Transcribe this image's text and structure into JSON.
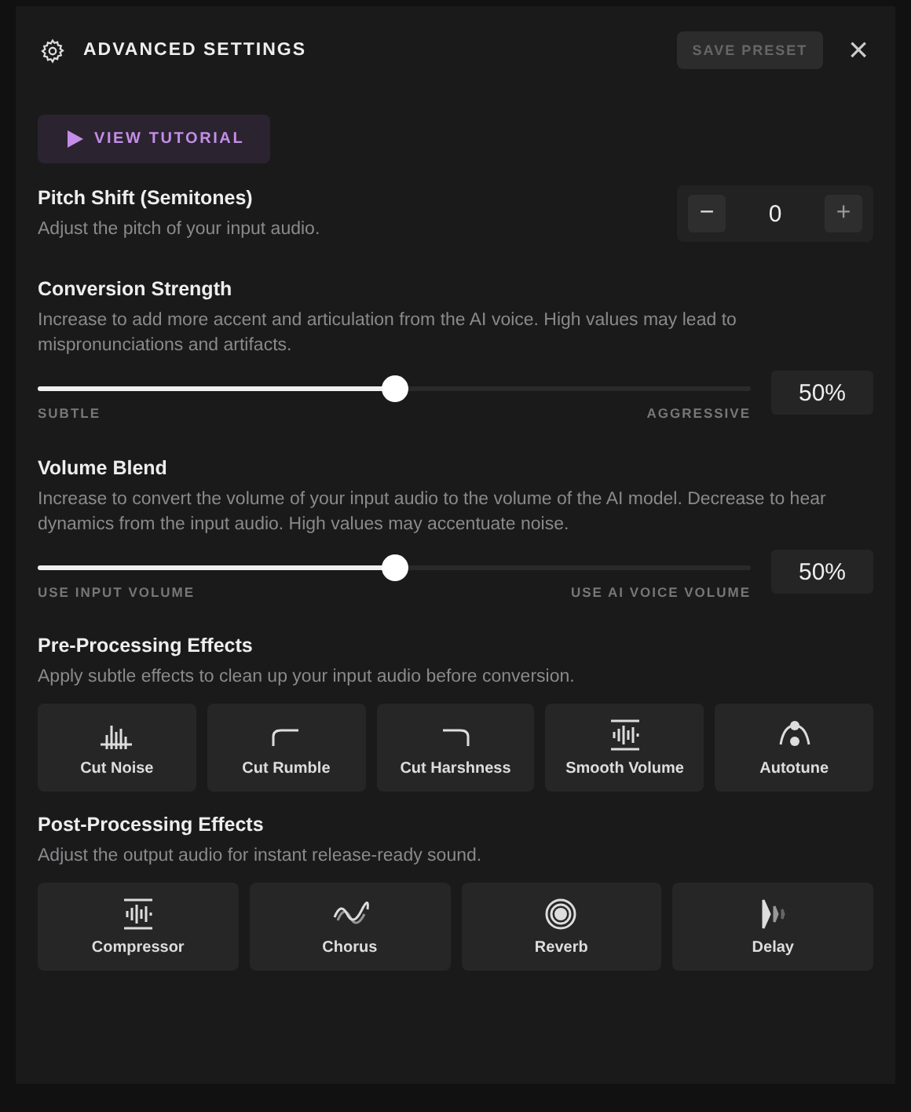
{
  "header": {
    "title": "ADVANCED SETTINGS",
    "save_button": "SAVE PRESET",
    "close": "×"
  },
  "tutorial_button": "VIEW TUTORIAL",
  "pitch": {
    "title": "Pitch Shift (Semitones)",
    "description": "Adjust the pitch of your input audio.",
    "value": "0",
    "minus": "−",
    "plus": "+"
  },
  "sliders": [
    {
      "title": "Conversion Strength",
      "description": "Increase to add more accent and articulation from the AI voice. High values may lead to mispronunciations and artifacts.",
      "level": 0.5,
      "min_label": "SUBTLE",
      "max_label": "AGGRESSIVE",
      "reading": "50%"
    },
    {
      "title": "Volume Blend",
      "description": "Increase to convert the volume of your input audio to the volume of the AI model. Decrease to hear dynamics from the input audio. High values may accentuate noise.",
      "level": 0.5,
      "min_label": "USE INPUT VOLUME",
      "max_label": "USE AI VOICE VOLUME",
      "reading": "50%"
    }
  ],
  "effect_groups": [
    {
      "title": "Pre-Processing Effects",
      "description": "Apply subtle effects to clean up your input audio before conversion.",
      "effects": [
        {
          "label": "Cut Noise",
          "kind": "noise"
        },
        {
          "label": "Cut Rumble",
          "kind": "lowcut"
        },
        {
          "label": "Cut Harshness",
          "kind": "highcut"
        },
        {
          "label": "Smooth Volume",
          "kind": "compress"
        },
        {
          "label": "Autotune",
          "kind": "autotune"
        }
      ]
    },
    {
      "title": "Post-Processing Effects",
      "description": "Adjust the output audio for instant release-ready sound.",
      "effects": [
        {
          "label": "Compressor",
          "kind": "compress"
        },
        {
          "label": "Chorus",
          "kind": "chorus"
        },
        {
          "label": "Reverb",
          "kind": "reverb"
        },
        {
          "label": "Delay",
          "kind": "delay"
        }
      ]
    }
  ]
}
